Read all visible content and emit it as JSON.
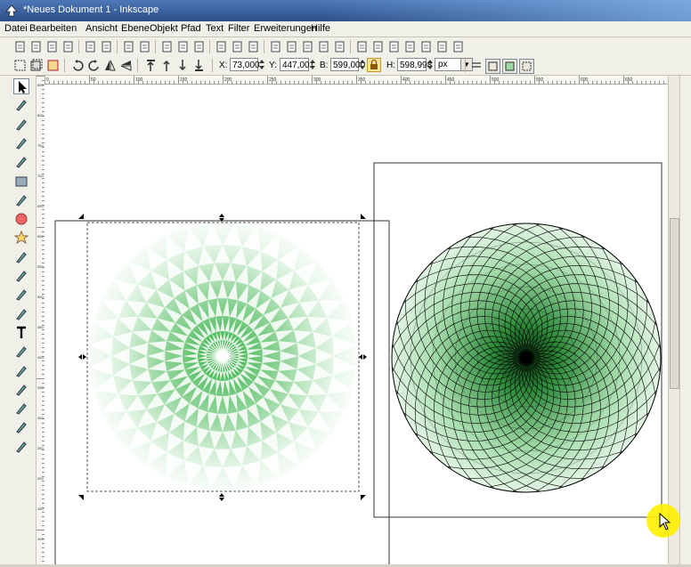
{
  "window": {
    "title": "*Neues Dokument 1 - Inkscape"
  },
  "menu": [
    {
      "label": "Datei"
    },
    {
      "label": "Bearbeiten"
    },
    {
      "label": "Ansicht"
    },
    {
      "label": "Ebene"
    },
    {
      "label": "Objekt"
    },
    {
      "label": "Pfad"
    },
    {
      "label": "Text"
    },
    {
      "label": "Filter"
    },
    {
      "label": "Erweiterungen"
    },
    {
      "label": "Hilfe"
    }
  ],
  "toolbar_commands": [
    "new-document-icon",
    "open-icon",
    "save-icon",
    "print-icon",
    "import-icon",
    "export-icon",
    "undo-icon",
    "redo-icon",
    "copy-icon",
    "cut-icon",
    "paste-icon",
    "zoom-selection-icon",
    "zoom-drawing-icon",
    "zoom-page-icon",
    "duplicate-icon",
    "clone-icon",
    "unlink-clone-icon",
    "group-icon",
    "ungroup-icon",
    "fill-stroke-icon",
    "text-font-icon",
    "xml-editor-icon",
    "align-icon",
    "transform-icon",
    "preferences-icon",
    "document-properties-icon"
  ],
  "selector": {
    "x_label": "X:",
    "x_value": "73,000",
    "y_label": "Y:",
    "y_value": "447,001",
    "w_label": "B:",
    "w_value": "599,000",
    "h_label": "H:",
    "h_value": "598,998",
    "unit": "px"
  },
  "ruler": {
    "h_ticks": [
      "0",
      "50",
      "100",
      "150",
      "200",
      "250",
      "300",
      "350",
      "400",
      "450",
      "500",
      "550",
      "600",
      "650",
      "700"
    ],
    "v_ticks": [
      "850",
      "800",
      "750",
      "700",
      "650",
      "600",
      "550",
      "500",
      "450",
      "400",
      "350",
      "300",
      "250",
      "200",
      "150",
      "100"
    ]
  },
  "tools": [
    "selector-tool-icon",
    "node-tool-icon",
    "tweak-tool-icon",
    "zoom-tool-icon",
    "measure-tool-icon",
    "rectangle-tool-icon",
    "3d-box-tool-icon",
    "ellipse-tool-icon",
    "star-tool-icon",
    "spiral-tool-icon",
    "pencil-tool-icon",
    "pen-tool-icon",
    "calligraphy-tool-icon",
    "text-tool-icon",
    "spray-tool-icon",
    "eraser-tool-icon",
    "paint-bucket-tool-icon",
    "gradient-tool-icon",
    "dropper-tool-icon",
    "connector-tool-icon"
  ],
  "colors": {
    "accent": "#2e7d32",
    "light_green": "#9ed8a6",
    "cursor_highlight": "#fff000"
  }
}
